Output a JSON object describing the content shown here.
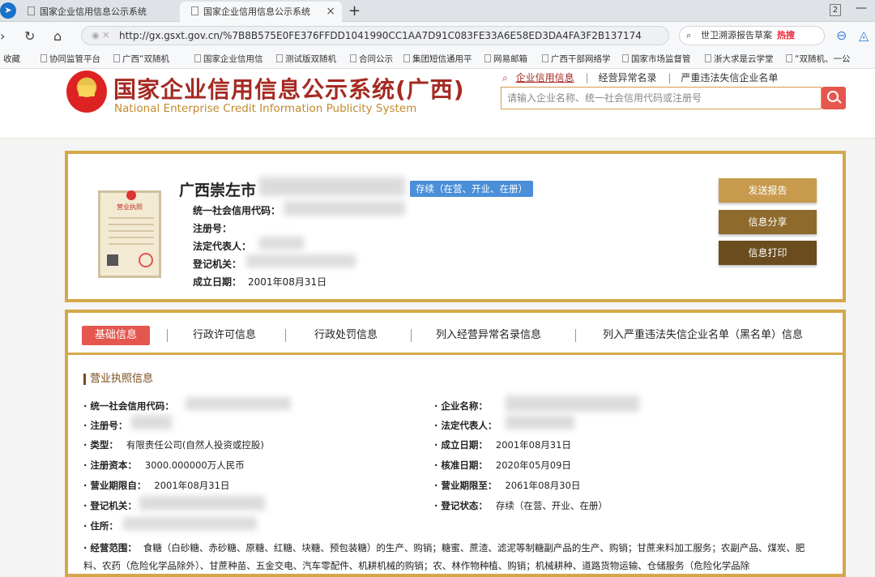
{
  "browser": {
    "tabs": [
      {
        "label": "国家企业信用信息公示系统"
      },
      {
        "label": "国家企业信用信息公示系统"
      }
    ],
    "window_count": "2",
    "url": "http://gx.gsxt.gov.cn/%7B8B575E0FE376FFDD1041990CC1AA7D91C083FE33A6E58ED3DA4FA3F2B137174",
    "search_text": "世卫溯源报告草案",
    "hot_label": "热搜",
    "bookmarks": [
      "收藏",
      "协同监管平台",
      "广西“双随机",
      "国家企业信用信",
      "测试版双随机",
      "合同公示",
      "集团短信通用平",
      "网易邮箱",
      "广西干部网络学",
      "国家市场监督管",
      "浙大求是云学堂",
      "“双随机、一公"
    ]
  },
  "site": {
    "title": "国家企业信用信息公示系统(广西)",
    "subtitle": "National Enterprise Credit Information Publicity System",
    "nav": [
      "企业信用信息",
      "经营异常名录",
      "严重违法失信企业名单"
    ],
    "search_placeholder": "请输入企业名称、统一社会信用代码或注册号"
  },
  "company": {
    "name": "广西崇左市",
    "status": "存续（在营、开业、在册）",
    "license_title": "营业执照",
    "fields": [
      {
        "label": "统一社会信用代码：",
        "value": ""
      },
      {
        "label": "注册号：",
        "value": ""
      },
      {
        "label": "法定代表人：",
        "value": ""
      },
      {
        "label": "登记机关：",
        "value": ""
      },
      {
        "label": "成立日期：",
        "value": "2001年08月31日"
      }
    ],
    "buttons": [
      "发送报告",
      "信息分享",
      "信息打印"
    ]
  },
  "panel": {
    "tabs": [
      "基础信息",
      "行政许可信息",
      "行政处罚信息",
      "列入经营异常名录信息",
      "列入严重违法失信企业名单（黑名单）信息"
    ],
    "section_title": "营业执照信息",
    "left": [
      {
        "label": "· 统一社会信用代码：",
        "value": ""
      },
      {
        "label": "· 注册号：",
        "value": ""
      },
      {
        "label": "· 类型：",
        "value": "有限责任公司(自然人投资或控股)"
      },
      {
        "label": "· 注册资本：",
        "value": "3000.000000万人民币"
      },
      {
        "label": "· 营业期限自：",
        "value": "2001年08月31日"
      },
      {
        "label": "· 登记机关：",
        "value": ""
      },
      {
        "label": "· 住所：",
        "value": ""
      }
    ],
    "right": [
      {
        "label": "· 企业名称：",
        "value": ""
      },
      {
        "label": "· 法定代表人：",
        "value": ""
      },
      {
        "label": "· 成立日期：",
        "value": "2001年08月31日"
      },
      {
        "label": "· 核准日期：",
        "value": "2020年05月09日"
      },
      {
        "label": "· 营业期限至：",
        "value": "2061年08月30日"
      },
      {
        "label": "· 登记状态：",
        "value": "存续（在营、开业、在册）"
      }
    ],
    "scope_label": "· 经营范围：",
    "scope_value": "食糖（白砂糖、赤砂糖、原糖、红糖、块糖、预包装糖）的生产、购销；糖蜜、蔗渣、滤泥等制糖副产品的生产、购销；甘蔗来料加工服务；农副产品、煤炭、肥料、农药（危险化学品除外）、甘蔗种苗、五金交电、汽车零配件、机耕机械的购销；农、林作物种植、购销；机械耕种、道路货物运输、仓储服务（危险化学品除"
  }
}
